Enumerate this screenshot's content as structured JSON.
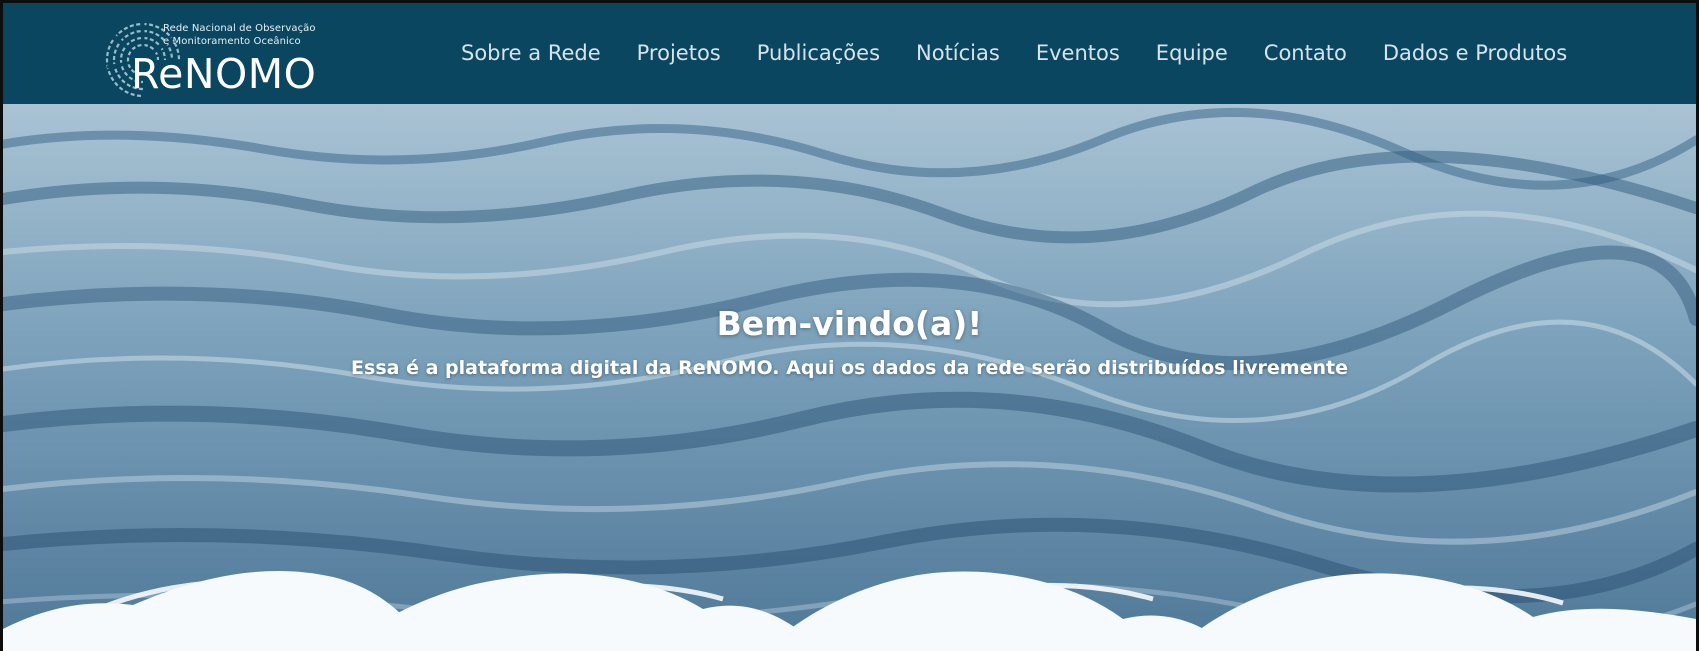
{
  "brand": {
    "name": "ReNOMO",
    "tagline_line1": "Rede Nacional de Observação",
    "tagline_line2": "e Monitoramento Oceânico"
  },
  "nav": {
    "items": [
      {
        "label": "Sobre a Rede"
      },
      {
        "label": "Projetos"
      },
      {
        "label": "Publicações"
      },
      {
        "label": "Notícias"
      },
      {
        "label": "Eventos"
      },
      {
        "label": "Equipe"
      },
      {
        "label": "Contato"
      },
      {
        "label": "Dados e Produtos"
      }
    ]
  },
  "hero": {
    "title": "Bem-vindo(a)!",
    "subtitle": "Essa é a plataforma digital da ReNOMO. Aqui os dados da rede serão distribuídos livremente"
  },
  "colors": {
    "header_bg": "#0b4660",
    "nav_text": "#d5e4ea",
    "hero_text": "#ffffff",
    "wave_fill": "#f6fafc"
  },
  "icons": {
    "logo_emblem": "radial-grid-globe-icon"
  }
}
